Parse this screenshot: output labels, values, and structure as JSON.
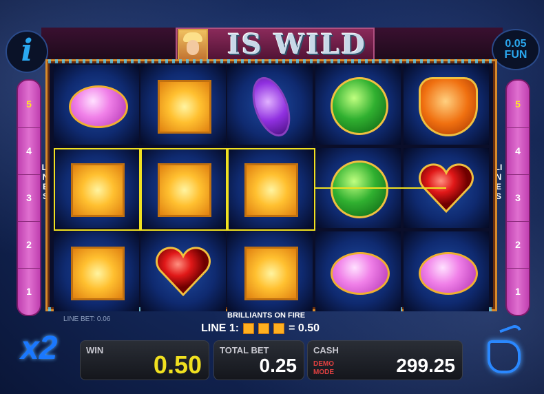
{
  "header": {
    "logo_text": "IS WILD"
  },
  "info_button": {
    "label": "i"
  },
  "denomination": {
    "value": "0.05",
    "currency": "FUN"
  },
  "lines_panel": {
    "word": "LINES",
    "numbers": [
      "5",
      "4",
      "3",
      "2",
      "1"
    ],
    "active": "5"
  },
  "reels": [
    [
      "pink-oval",
      "gold-square",
      "gold-square"
    ],
    [
      "gold-square",
      "gold-square",
      "red-heart"
    ],
    [
      "purple-marquise",
      "gold-square",
      "gold-square"
    ],
    [
      "green-round",
      "green-round",
      "pink-oval"
    ],
    [
      "orange-trillion",
      "red-heart",
      "pink-oval"
    ]
  ],
  "info": {
    "line_bet": "LINE BET: 0.06",
    "game_title": "BRILLIANTS ON FIRE",
    "line_label": "LINE 1:",
    "line_win": "= 0.50"
  },
  "multiplier": "x2",
  "panels": {
    "win": {
      "label": "WIN",
      "value": "0.50"
    },
    "total_bet": {
      "label": "TOTAL BET",
      "value": "0.25"
    },
    "cash": {
      "label": "CASH",
      "value": "299.25",
      "demo_line1": "DEMO",
      "demo_line2": "MODE"
    }
  },
  "colors": {
    "win_line": "#f0e020",
    "accent_blue": "#2aa8f0",
    "lines_panel": "#e070d0"
  }
}
